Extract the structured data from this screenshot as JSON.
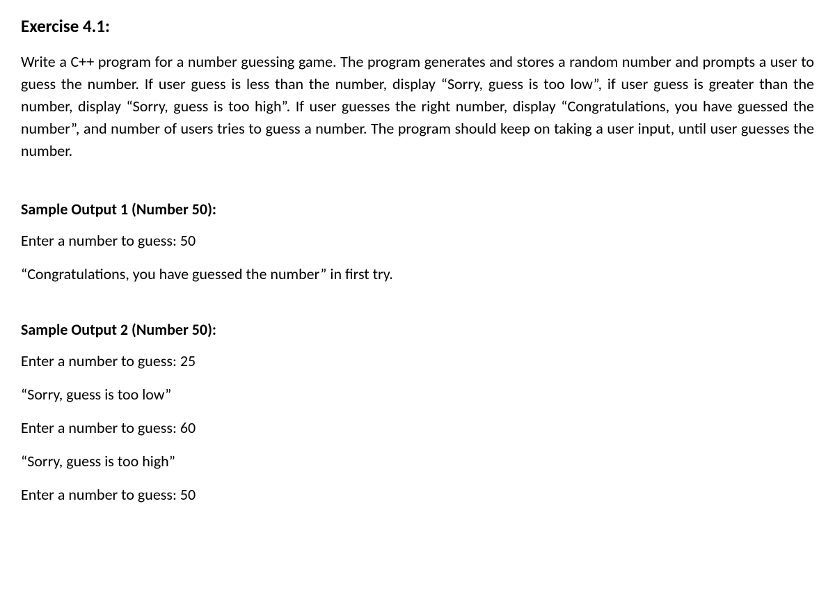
{
  "title": "Exercise 4.1:",
  "description": "Write a C++ program for a number guessing game. The program generates and stores a random number and prompts a user to guess the number. If user guess is less than the number, display “Sorry, guess is too low”, if user guess is greater than the number, display “Sorry, guess is too high”. If user guesses the right number, display “Congratulations, you have guessed the number”, and number of users tries to guess a number.  The program should keep on taking a user input, until user guesses the number.",
  "sample1": {
    "heading": "Sample Output 1 (Number 50):",
    "lines": [
      "Enter a number to guess: 50",
      "“Congratulations, you have guessed the number” in first try."
    ]
  },
  "sample2": {
    "heading": "Sample Output 2 (Number 50):",
    "lines": [
      "Enter a number to guess: 25",
      "“Sorry, guess is too low”",
      "Enter a number to guess: 60",
      "“Sorry, guess is too high”",
      "Enter a number to guess: 50"
    ]
  }
}
